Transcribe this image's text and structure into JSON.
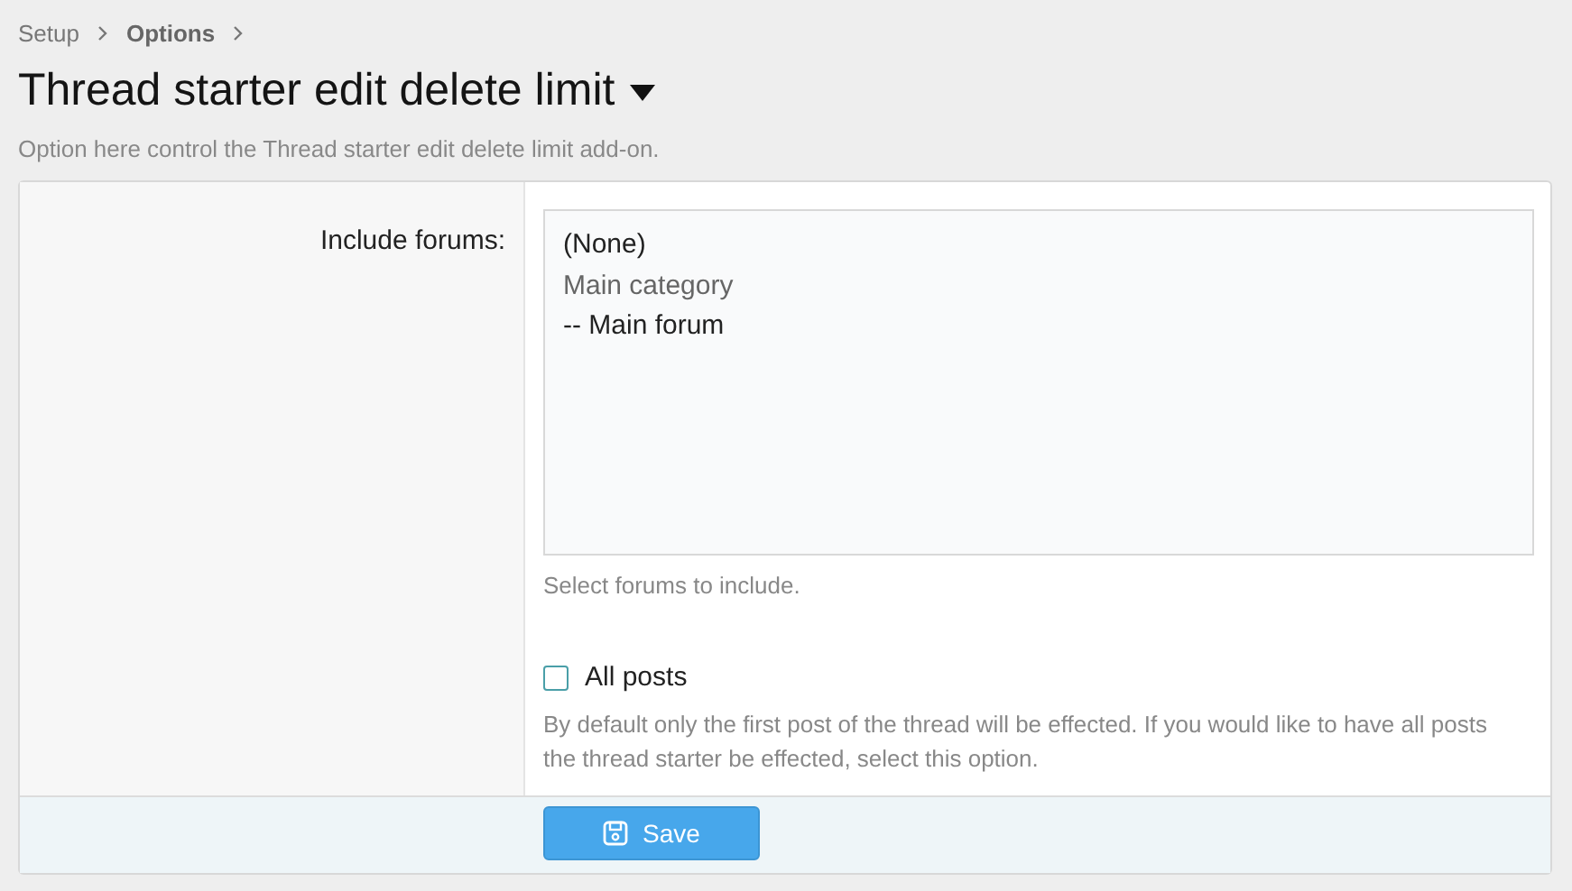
{
  "breadcrumb": [
    {
      "label": "Setup",
      "current": false
    },
    {
      "label": "Options",
      "current": true
    }
  ],
  "title": "Thread starter edit delete limit",
  "description": "Option here control the Thread starter edit delete limit add-on.",
  "include_forums": {
    "label": "Include forums:",
    "options": [
      {
        "label": "(None)",
        "disabled": false
      },
      {
        "label": "Main category",
        "disabled": true
      },
      {
        "label": "-- Main forum",
        "disabled": false
      }
    ],
    "hint": "Select forums to include."
  },
  "all_posts": {
    "label": "All posts",
    "checked": false,
    "hint_lines": [
      "By default only the first post of the thread will be effected. If you would like to have all posts",
      "the thread starter be effected, select this option."
    ]
  },
  "save_button": "Save"
}
